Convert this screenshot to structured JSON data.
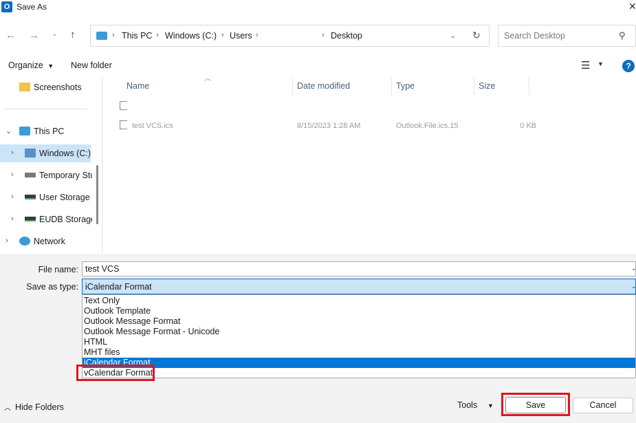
{
  "window": {
    "title": "Save As",
    "app_icon_letter": "O"
  },
  "address_bar": {
    "crumbs": [
      "This PC",
      "Windows (C:)",
      "Users",
      "Desktop"
    ],
    "search_placeholder": "Search Desktop"
  },
  "toolbar": {
    "organize_label": "Organize",
    "new_folder_label": "New folder"
  },
  "sidebar": {
    "items": [
      {
        "label": "Screenshots"
      },
      {
        "label": "This PC"
      },
      {
        "label": "Windows (C:)"
      },
      {
        "label": "Temporary Sto"
      },
      {
        "label": "User Storage -"
      },
      {
        "label": "EUDB Storage"
      },
      {
        "label": "Network"
      }
    ]
  },
  "file_list": {
    "columns": [
      "Name",
      "Date modified",
      "Type",
      "Size"
    ],
    "rows": [
      {
        "name": "test VCS.ics",
        "date": "8/15/2023 1:28 AM",
        "type": "Outlook.File.ics.15",
        "size": "0 KB"
      }
    ]
  },
  "form": {
    "file_name_label": "File name:",
    "file_name_value": "test VCS",
    "save_as_type_label": "Save as type:",
    "save_as_type_value": "iCalendar Format",
    "type_options": [
      "Text Only",
      "Outlook Template",
      "Outlook Message Format",
      "Outlook Message Format - Unicode",
      "HTML",
      "MHT files",
      "iCalendar Format",
      "vCalendar Format"
    ],
    "selected_option_index": 6,
    "highlighted_option_index": 7
  },
  "footer": {
    "hide_folders_label": "Hide Folders",
    "tools_label": "Tools",
    "save_label": "Save",
    "cancel_label": "Cancel"
  },
  "colors": {
    "accent": "#0078d7",
    "highlight_box": "#e0141e",
    "selected_bg": "#cce4f7"
  }
}
